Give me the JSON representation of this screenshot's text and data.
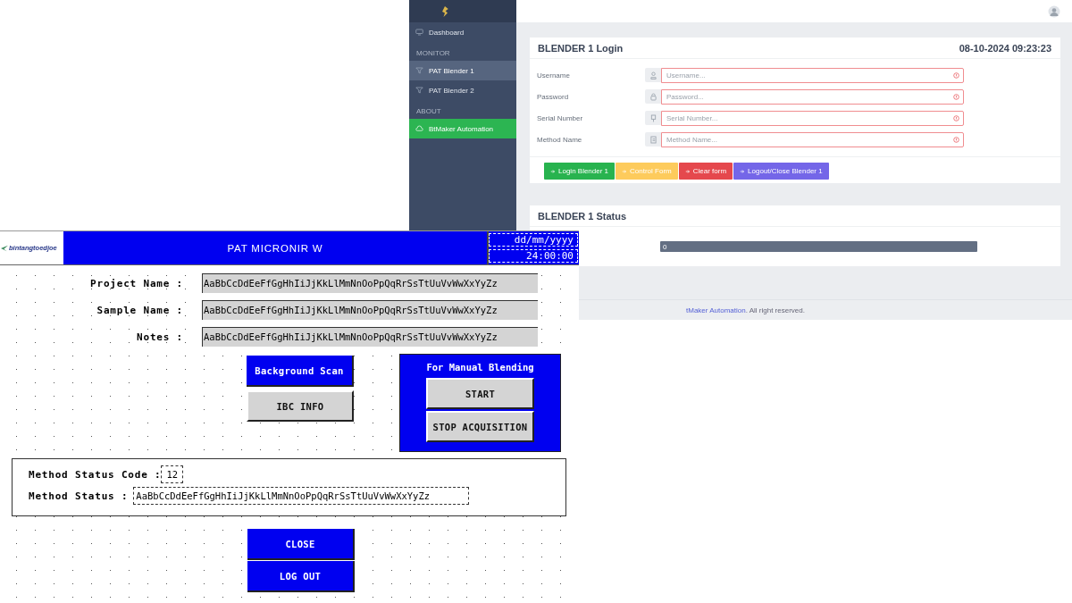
{
  "web_app": {
    "sidebar": {
      "items": [
        {
          "kind": "link",
          "label": "Dashboard",
          "selected": false,
          "highlighted": false
        },
        {
          "kind": "heading",
          "label": "MONITOR"
        },
        {
          "kind": "link",
          "label": "PAT Blender 1",
          "selected": false,
          "highlighted": true
        },
        {
          "kind": "link",
          "label": "PAT Blender 2",
          "selected": false,
          "highlighted": false
        },
        {
          "kind": "heading",
          "label": "ABOUT"
        },
        {
          "kind": "link",
          "label": "BtMaker Automation",
          "selected": true,
          "highlighted": false
        }
      ]
    },
    "login_card": {
      "title": "BLENDER 1 Login",
      "datetime": "08-10-2024 09:23:23",
      "fields": [
        {
          "label": "Username",
          "placeholder": "Username...",
          "invalid": true
        },
        {
          "label": "Password",
          "placeholder": "Password...",
          "invalid": true
        },
        {
          "label": "Serial Number",
          "placeholder": "Serial Number...",
          "invalid": true
        },
        {
          "label": "Method Name",
          "placeholder": "Method Name...",
          "invalid": true
        }
      ],
      "buttons": [
        {
          "label": "Login Blender 1",
          "color": "#28b34f"
        },
        {
          "label": "Control Form",
          "color": "#fdcb5c"
        },
        {
          "label": "Clear form",
          "color": "#e5484d"
        },
        {
          "label": "Logout/Close Blender 1",
          "color": "#7466e8"
        }
      ]
    },
    "status_card": {
      "title": "BLENDER 1 Status",
      "progress": {
        "level": 0,
        "label": "0"
      }
    },
    "footer": {
      "link": "tMaker Automation",
      "text": ". All right reserved."
    }
  },
  "hmi": {
    "logo": "bintangtoedjoe",
    "title": "PAT MICRONIR W",
    "date": "dd/mm/yyyy",
    "time": "24:00:00",
    "fields": [
      {
        "label": "Project Name :",
        "value": "AaBbCcDdEeFfGgHhIiJjKkLlMmNnOoPpQqRrSsTtUuVvWwXxYyZz"
      },
      {
        "label": "Sample Name :",
        "value": "AaBbCcDdEeFfGgHhIiJjKkLlMmNnOoPpQqRrSsTtUuVvWwXxYyZz"
      },
      {
        "label": "Notes :",
        "value": "AaBbCcDdEeFfGgHhIiJjKkLlMmNnOoPpQqRrSsTtUuVvWwXxYyZz"
      }
    ],
    "side_buttons": [
      {
        "label": "Background Scan",
        "active": true
      },
      {
        "label": "IBC INFO",
        "active": false
      }
    ],
    "manual_panel": {
      "title": "For Manual Blending",
      "buttons": [
        "START",
        "STOP ACQUISITION"
      ]
    },
    "method_status_code_label": "Method Status Code :",
    "method_status_code": "12",
    "method_status_label": "Method Status :",
    "method_status": "AaBbCcDdEeFfGgHhIiJjKkLlMmNnOoPpQqRrSsTtUuVvWwXxYyZz",
    "bottom_buttons": [
      "CLOSE",
      "LOG OUT"
    ]
  }
}
